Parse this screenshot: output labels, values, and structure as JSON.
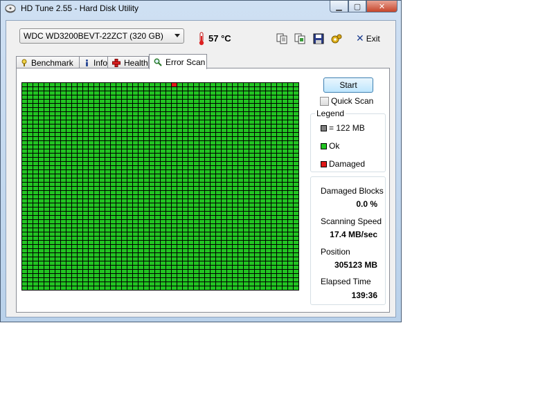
{
  "window": {
    "title": "HD Tune 2.55 - Hard Disk Utility",
    "caption": {
      "minimize": "▁",
      "maximize": "▢",
      "close": "✕"
    }
  },
  "toolbar": {
    "drive": "WDC WD3200BEVT-22ZCT (320 GB)",
    "temperature": "57 °C",
    "exit_label": "Exit",
    "icons": [
      "copy-text-icon",
      "copy-screenshot-icon",
      "save-icon",
      "options-icon"
    ]
  },
  "tabs": [
    {
      "label": "Benchmark",
      "icon": "benchmark-icon"
    },
    {
      "label": "Info",
      "icon": "info-icon"
    },
    {
      "label": "Health",
      "icon": "health-icon"
    },
    {
      "label": "Error Scan",
      "icon": "magnifier-icon",
      "active": true
    }
  ],
  "scan": {
    "grid_columns": 50,
    "grid_rows": 50,
    "damaged_blocks": [
      [
        0,
        27
      ]
    ],
    "colors": {
      "ok": "#22c422",
      "damaged": "#e01919",
      "block_size": "#808080"
    }
  },
  "controls": {
    "start_label": "Start",
    "quick_scan_label": "Quick Scan",
    "quick_scan_checked": false
  },
  "legend": {
    "title": "Legend",
    "block_size": "= 122 MB",
    "ok": "Ok",
    "damaged": "Damaged"
  },
  "stats": {
    "damaged_blocks_label": "Damaged Blocks",
    "damaged_blocks_value": "0.0 %",
    "speed_label": "Scanning Speed",
    "speed_value": "17.4 MB/sec",
    "position_label": "Position",
    "position_value": "305123 MB",
    "elapsed_label": "Elapsed Time",
    "elapsed_value": "139:36"
  }
}
